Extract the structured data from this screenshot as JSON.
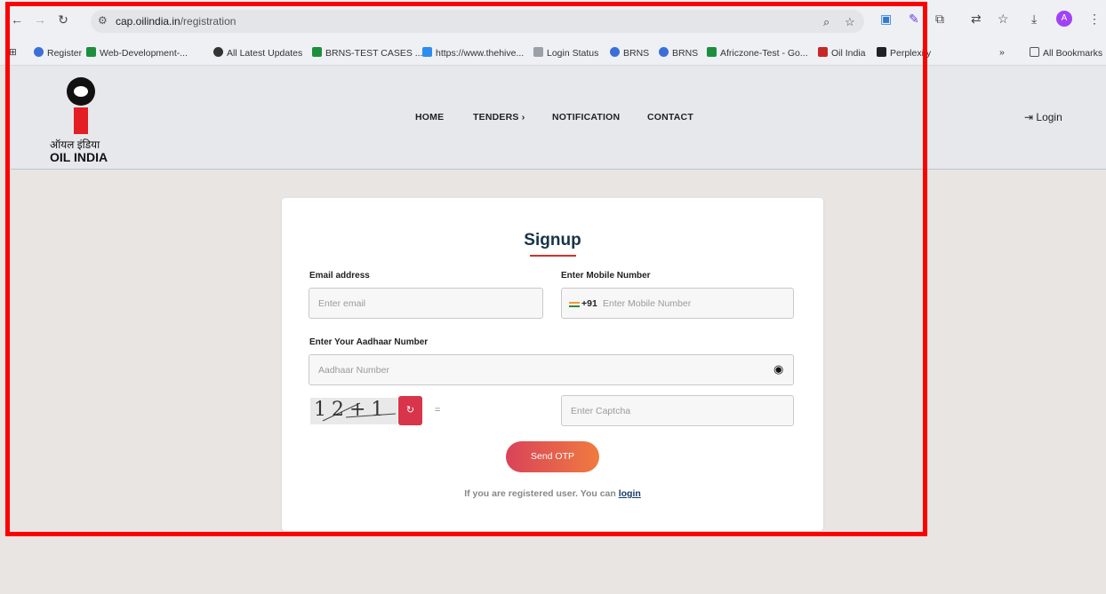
{
  "browser": {
    "url_host": "cap.oilindia.in",
    "url_path": "/registration",
    "bookmarks": [
      "Register",
      "Web-Development-...",
      "All Latest Updates",
      "BRNS-TEST CASES ...",
      "https://www.thehive...",
      "Login Status",
      "BRNS",
      "BRNS",
      "Africzone-Test - Go...",
      "Oil India",
      "Perplexity"
    ],
    "all_bookmarks": "All Bookmarks",
    "avatar_letter": "A"
  },
  "header": {
    "logo_hindi": "ऑयल इंडिया",
    "logo_english": "OIL INDIA",
    "nav": [
      "HOME",
      "TENDERS ›",
      "NOTIFICATION",
      "CONTACT"
    ],
    "login": "Login"
  },
  "form": {
    "title": "Signup",
    "email_label": "Email address",
    "email_placeholder": "Enter email",
    "mobile_label": "Enter Mobile Number",
    "country_code": "+91",
    "mobile_placeholder": "Enter Mobile Number",
    "aadhaar_label": "Enter Your Aadhaar Number",
    "aadhaar_placeholder": "Aadhaar Number",
    "captcha_text": "12+1",
    "captcha_eq": "=",
    "captcha_placeholder": "Enter Captcha",
    "send_otp": "Send OTP",
    "footer_text": "If you are registered user. You can ",
    "footer_link": "login"
  },
  "colors": {
    "title": "#17344a",
    "accent_red": "#d32f2f",
    "frame": "#ff0000"
  }
}
